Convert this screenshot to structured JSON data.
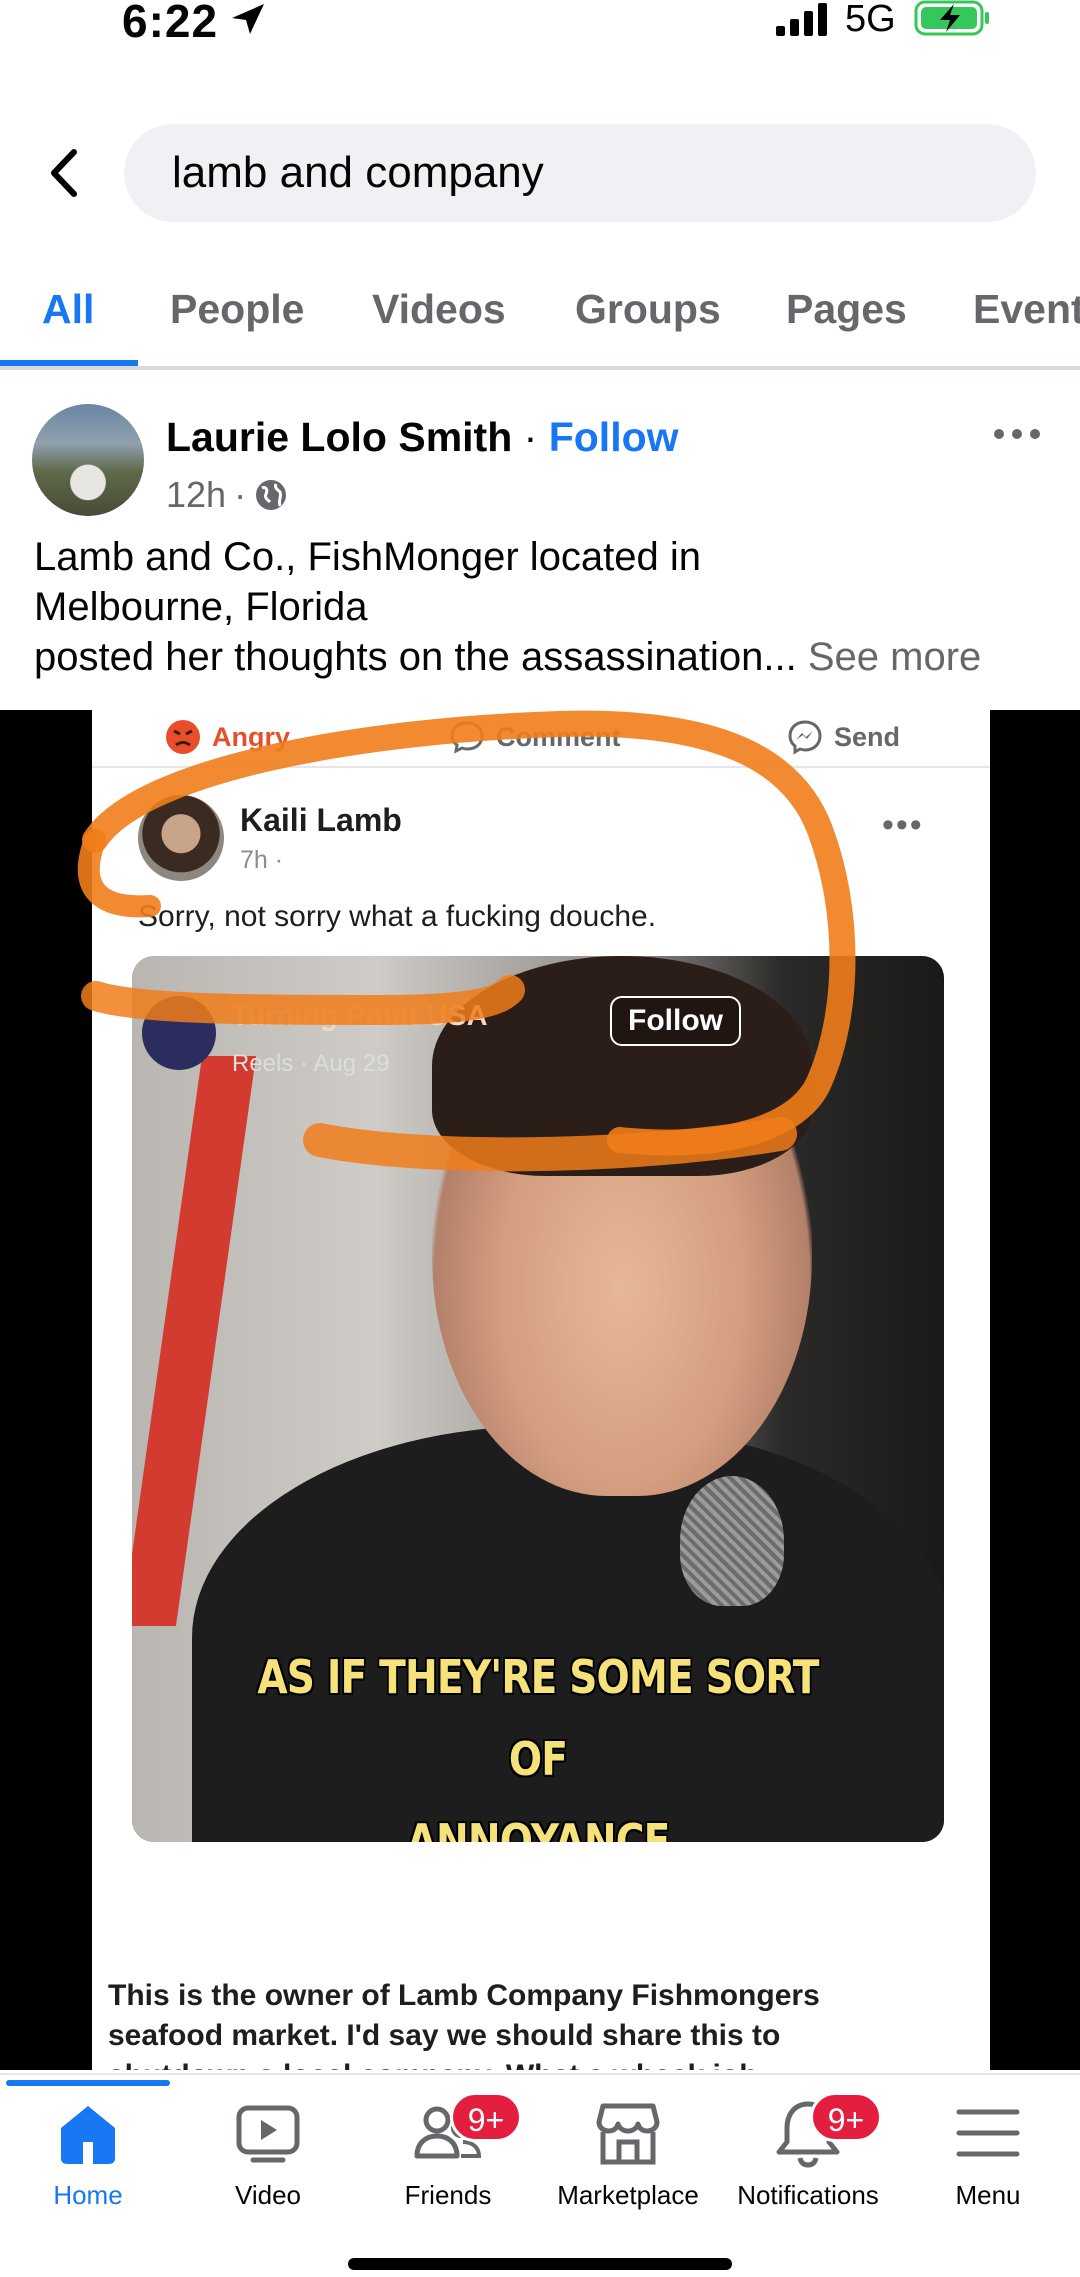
{
  "status_bar": {
    "time": "6:22",
    "network": "5G"
  },
  "search": {
    "query": "lamb and company"
  },
  "tabs": [
    {
      "label": "All",
      "active": true
    },
    {
      "label": "People"
    },
    {
      "label": "Videos"
    },
    {
      "label": "Groups"
    },
    {
      "label": "Pages"
    },
    {
      "label": "Event"
    }
  ],
  "post": {
    "author": "Laurie Lolo Smith",
    "separator": "·",
    "follow_label": "Follow",
    "time": "12h",
    "text_line1": "Lamb and Co., FishMonger located in",
    "text_line2": "Melbourne, Florida",
    "text_line3": "posted her thoughts on the assassination...",
    "see_more": "See more"
  },
  "embedded_screenshot": {
    "react_angry": "Angry",
    "react_comment": "Comment",
    "react_send": "Send",
    "name": "Kaili Lamb",
    "time": "7h ·",
    "caption": "Sorry, not sorry what a fucking douche.",
    "video_page": "Turning Point USA",
    "video_meta": "Reels · Aug 29",
    "video_follow": "Follow",
    "subtitle_line1": "AS IF THEY'RE SOME SORT OF",
    "subtitle_line2": "ANNOYANCE",
    "bottom_line1": "This is the owner of Lamb Company Fishmongers",
    "bottom_line2": "seafood market.  I'd say we should share this to",
    "bottom_line3": "shutdown a local company. What a whack job"
  },
  "bottom_nav": [
    {
      "label": "Home",
      "icon": "home-icon",
      "active": true
    },
    {
      "label": "Video",
      "icon": "video-icon"
    },
    {
      "label": "Friends",
      "icon": "friends-icon",
      "badge": "9+"
    },
    {
      "label": "Marketplace",
      "icon": "marketplace-icon"
    },
    {
      "label": "Notifications",
      "icon": "bell-icon",
      "badge": "9+"
    },
    {
      "label": "Menu",
      "icon": "menu-icon"
    }
  ],
  "colors": {
    "accent": "#1877f2",
    "badge": "#e41e3f",
    "annotation": "#f07d1a"
  }
}
